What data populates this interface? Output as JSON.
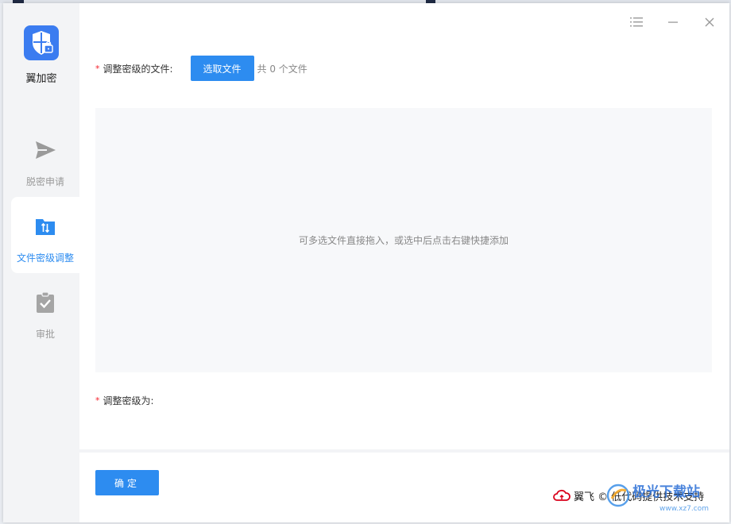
{
  "app": {
    "name": "翼加密",
    "brand_color": "#3b7cf0",
    "accent_color": "#2d8cf0"
  },
  "sidebar": {
    "items": [
      {
        "label": "脱密申请",
        "icon": "send-icon",
        "active": false
      },
      {
        "label": "文件密级调整",
        "icon": "folder-transfer-icon",
        "active": true
      },
      {
        "label": "审批",
        "icon": "clipboard-check-icon",
        "active": false
      }
    ]
  },
  "window_controls": [
    "menu-icon",
    "minimize-icon",
    "close-icon"
  ],
  "form": {
    "file_field": {
      "required_mark": "*",
      "label": "调整密级的文件:",
      "pick_button": "选取文件",
      "count_text": "共 0 个文件"
    },
    "dropzone_hint": "可多选文件直接拖入，或选中后点击右键快捷添加",
    "level_field": {
      "required_mark": "*",
      "label": "调整密级为:"
    },
    "confirm_button": "确定"
  },
  "footer": {
    "powered_by": "翼飞 © 低代码提供技术支持"
  },
  "watermark": {
    "text": "极光下载站",
    "url": "www.xz7.com"
  }
}
